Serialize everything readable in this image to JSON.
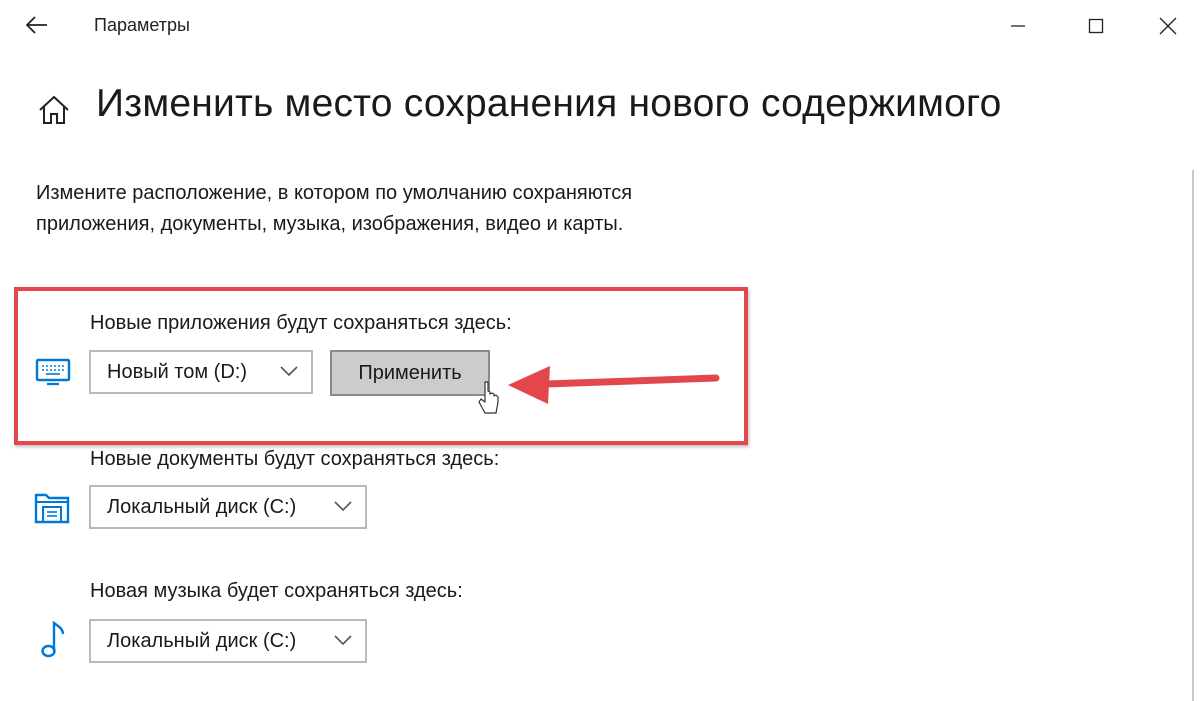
{
  "window": {
    "title": "Параметры"
  },
  "header": {
    "title": "Изменить место сохранения нового содержимого",
    "description": "Измените расположение, в котором по умолчанию сохраняются приложения, документы, музыка, изображения, видео и карты."
  },
  "sections": [
    {
      "label": "Новые приложения будут сохраняться здесь:",
      "icon": "monitor-icon",
      "selected": "Новый том (D:)",
      "apply_label": "Применить"
    },
    {
      "label": "Новые документы будут сохраняться здесь:",
      "icon": "documents-folder-icon",
      "selected": "Локальный диск (C:)"
    },
    {
      "label": "Новая музыка будет сохраняться здесь:",
      "icon": "music-note-icon",
      "selected": "Локальный диск (C:)"
    }
  ],
  "colors": {
    "accent": "#0078d7",
    "highlight": "#e4474b",
    "button_bg": "#cccccc"
  }
}
